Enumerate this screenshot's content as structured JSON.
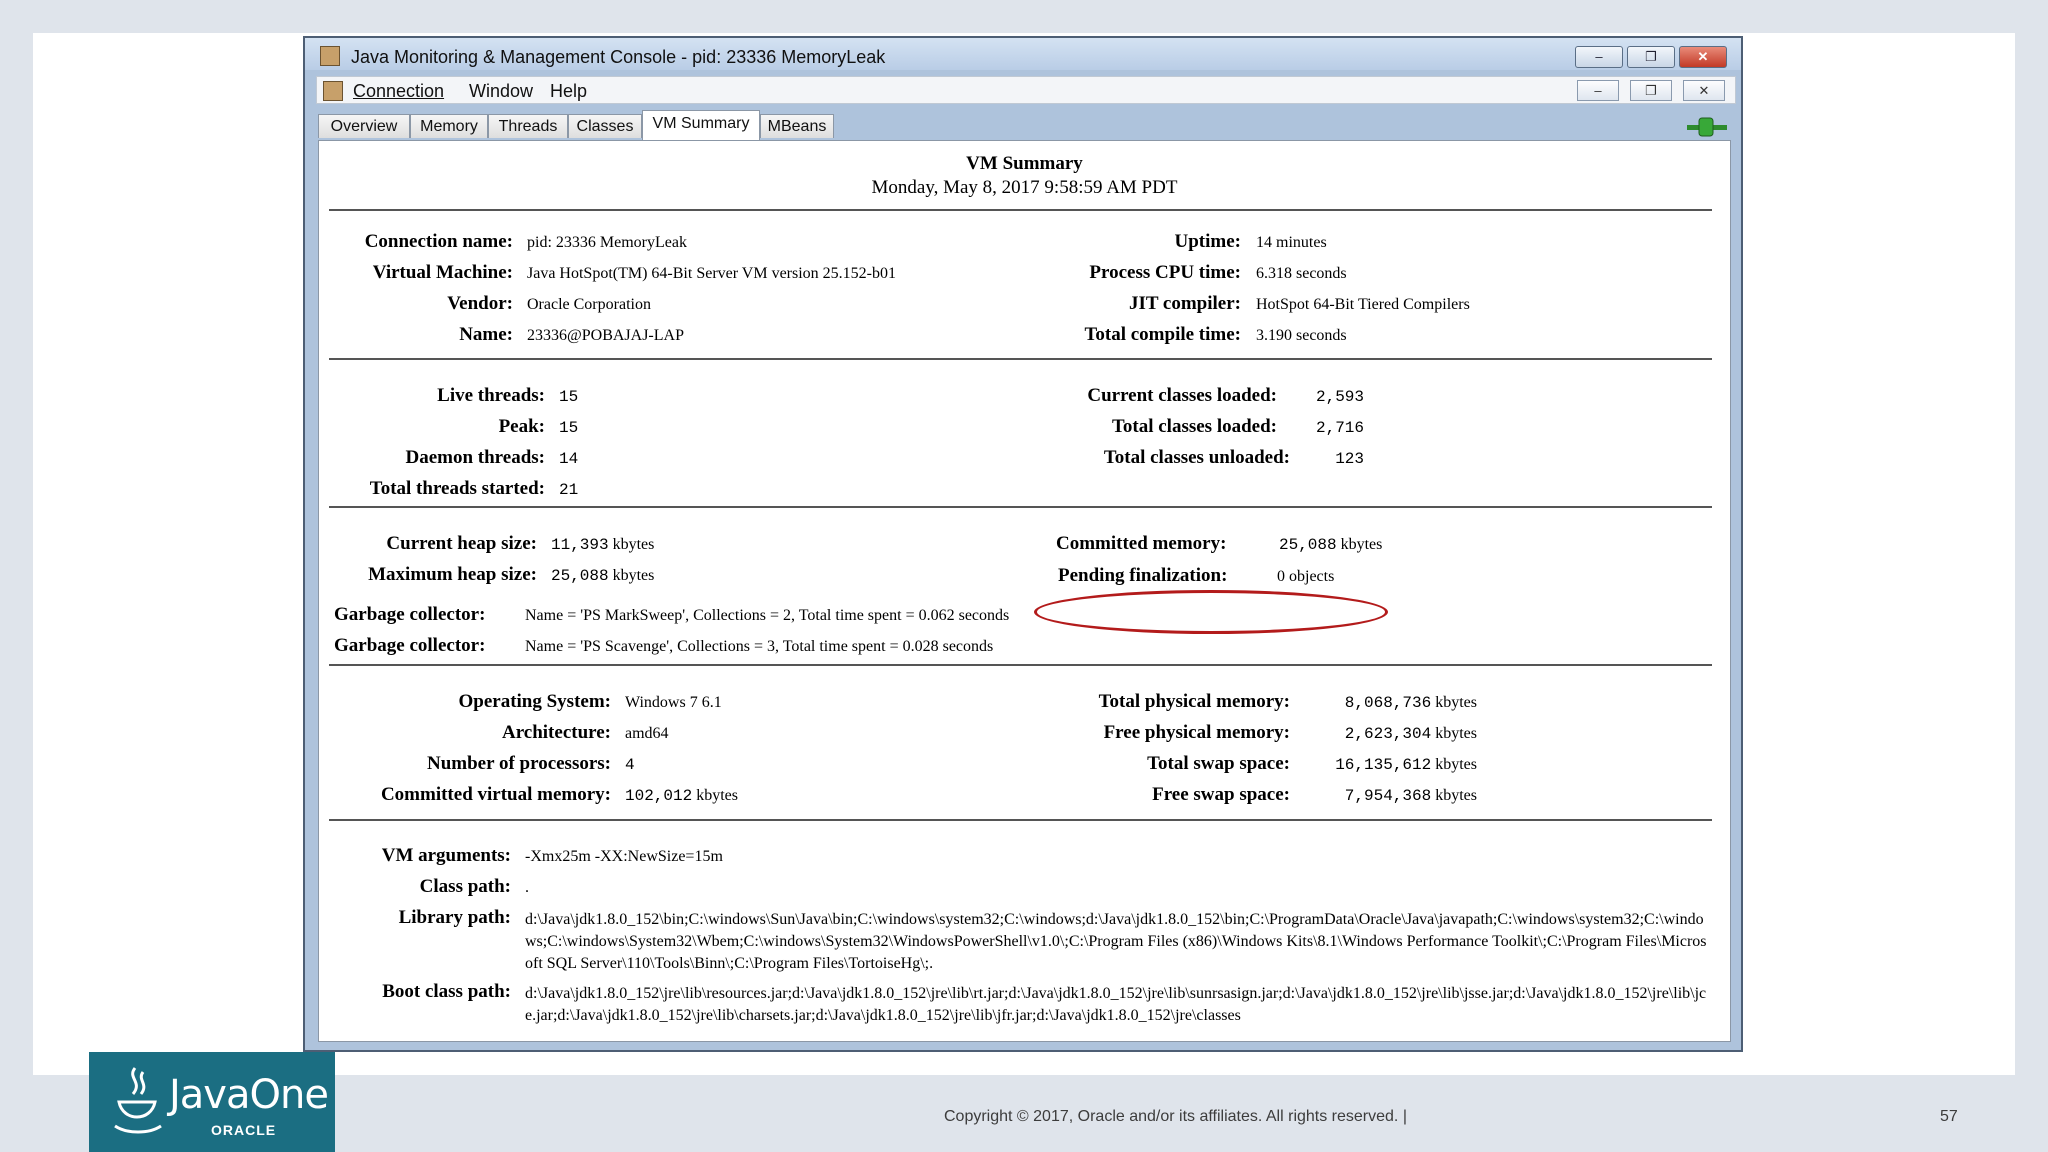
{
  "window": {
    "title": "Java Monitoring & Management Console - pid: 23336 MemoryLeak",
    "menu": [
      "Connection",
      "Window",
      "Help"
    ],
    "tabs": [
      "Overview",
      "Memory",
      "Threads",
      "Classes",
      "VM Summary",
      "MBeans"
    ],
    "active_tab": "VM Summary",
    "buttons": {
      "minimize": "–",
      "restore": "❐",
      "close": "✕"
    }
  },
  "summary": {
    "title": "VM Summary",
    "date": "Monday, May 8, 2017 9:58:59 AM PDT"
  },
  "section1": {
    "left": [
      {
        "label": "Connection name:",
        "value": "pid: 23336 MemoryLeak"
      },
      {
        "label": "Virtual Machine:",
        "value": "Java HotSpot(TM) 64-Bit Server VM version 25.152-b01"
      },
      {
        "label": "Vendor:",
        "value": "Oracle Corporation"
      },
      {
        "label": "Name:",
        "value": "23336@POBAJAJ-LAP"
      }
    ],
    "right": [
      {
        "label": "Uptime:",
        "value": "14 minutes"
      },
      {
        "label": "Process CPU time:",
        "value": "6.318 seconds"
      },
      {
        "label": "JIT compiler:",
        "value": "HotSpot 64-Bit Tiered Compilers"
      },
      {
        "label": "Total compile time:",
        "value": "3.190 seconds"
      }
    ]
  },
  "section2": {
    "left": [
      {
        "label": "Live threads:",
        "value": "15"
      },
      {
        "label": "Peak:",
        "value": "15"
      },
      {
        "label": "Daemon threads:",
        "value": "14"
      },
      {
        "label": "Total threads started:",
        "value": "21"
      }
    ],
    "right": [
      {
        "label": "Current classes loaded:",
        "value": "2,593"
      },
      {
        "label": "Total classes loaded:",
        "value": "2,716"
      },
      {
        "label": "Total classes unloaded:",
        "value": "123"
      }
    ]
  },
  "section3": {
    "current_heap": {
      "label": "Current heap size:",
      "value": "11,393",
      "unit": "kbytes"
    },
    "max_heap": {
      "label": "Maximum heap size:",
      "value": "25,088",
      "unit": "kbytes"
    },
    "committed_memory": {
      "label": "Committed memory:",
      "value": "25,088",
      "unit": "kbytes"
    },
    "pending_finalization": {
      "label": "Pending finalization:",
      "value": "0 objects"
    },
    "gc": [
      {
        "label": "Garbage collector:",
        "value": "Name = 'PS MarkSweep', Collections = 2, Total time spent = 0.062 seconds"
      },
      {
        "label": "Garbage collector:",
        "value": "Name = 'PS Scavenge', Collections = 3, Total time spent = 0.028 seconds"
      }
    ]
  },
  "section4": {
    "left": [
      {
        "label": "Operating System:",
        "value": "Windows 7 6.1"
      },
      {
        "label": "Architecture:",
        "value": "amd64"
      },
      {
        "label": "Number of processors:",
        "value": "4"
      },
      {
        "label": "Committed virtual memory:",
        "value": "102,012",
        "unit": "kbytes"
      }
    ],
    "right": [
      {
        "label": "Total physical memory:",
        "value": "8,068,736",
        "unit": "kbytes"
      },
      {
        "label": "Free physical memory:",
        "value": "2,623,304",
        "unit": "kbytes"
      },
      {
        "label": "Total swap space:",
        "value": "16,135,612",
        "unit": "kbytes"
      },
      {
        "label": "Free swap space:",
        "value": "7,954,368",
        "unit": "kbytes"
      }
    ]
  },
  "section5": {
    "vm_arguments": {
      "label": "VM arguments:",
      "value": "-Xmx25m -XX:NewSize=15m"
    },
    "class_path": {
      "label": "Class path:",
      "value": "."
    },
    "library_path": {
      "label": "Library path:",
      "value": "d:\\Java\\jdk1.8.0_152\\bin;C:\\windows\\Sun\\Java\\bin;C:\\windows\\system32;C:\\windows;d:\\Java\\jdk1.8.0_152\\bin;C:\\ProgramData\\Oracle\\Java\\javapath;C:\\windows\\system32;C:\\windows;C:\\windows\\System32\\Wbem;C:\\windows\\System32\\WindowsPowerShell\\v1.0\\;C:\\Program Files (x86)\\Windows Kits\\8.1\\Windows Performance Toolkit\\;C:\\Program Files\\Microsoft SQL Server\\110\\Tools\\Binn\\;C:\\Program Files\\TortoiseHg\\;."
    },
    "boot_class_path": {
      "label": "Boot class path:",
      "value": "d:\\Java\\jdk1.8.0_152\\jre\\lib\\resources.jar;d:\\Java\\jdk1.8.0_152\\jre\\lib\\rt.jar;d:\\Java\\jdk1.8.0_152\\jre\\lib\\sunrsasign.jar;d:\\Java\\jdk1.8.0_152\\jre\\lib\\jsse.jar;d:\\Java\\jdk1.8.0_152\\jre\\lib\\jce.jar;d:\\Java\\jdk1.8.0_152\\jre\\lib\\charsets.jar;d:\\Java\\jdk1.8.0_152\\jre\\lib\\jfr.jar;d:\\Java\\jdk1.8.0_152\\jre\\classes"
    }
  },
  "slide": {
    "logo_text": "JavaOne",
    "logo_sub": "ORACLE",
    "copyright": "Copyright © 2017, Oracle and/or its affiliates. All rights reserved.  |",
    "page_number": "57"
  },
  "colors": {
    "highlight_ellipse": "#b31b1b",
    "logo_bg": "#1b6e82"
  }
}
